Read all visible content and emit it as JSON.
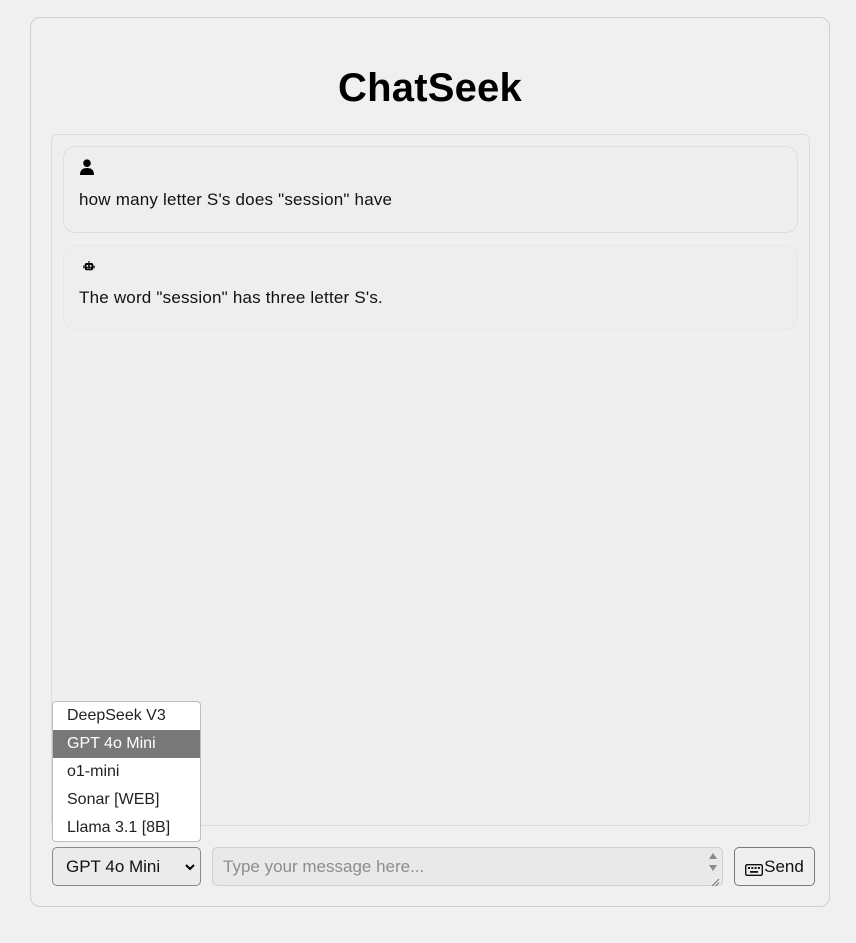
{
  "app": {
    "title": "ChatSeek"
  },
  "messages": [
    {
      "role": "user",
      "icon": "user-icon",
      "text": "how many letter S's does \"session\" have"
    },
    {
      "role": "bot",
      "icon": "robot-icon",
      "text": "The word \"session\" has three letter S's."
    }
  ],
  "model_select": {
    "selected": "GPT 4o Mini",
    "options": [
      "DeepSeek V3",
      "GPT 4o Mini",
      "o1-mini",
      "Sonar [WEB]",
      "Llama 3.1 [8B]"
    ]
  },
  "input": {
    "value": "",
    "placeholder": "Type your message here..."
  },
  "send_button": {
    "icon": "keyboard-icon",
    "label": "Send"
  },
  "colors": {
    "background": "#f0f0f0",
    "selected_option": "#787878",
    "text": "#111111"
  }
}
